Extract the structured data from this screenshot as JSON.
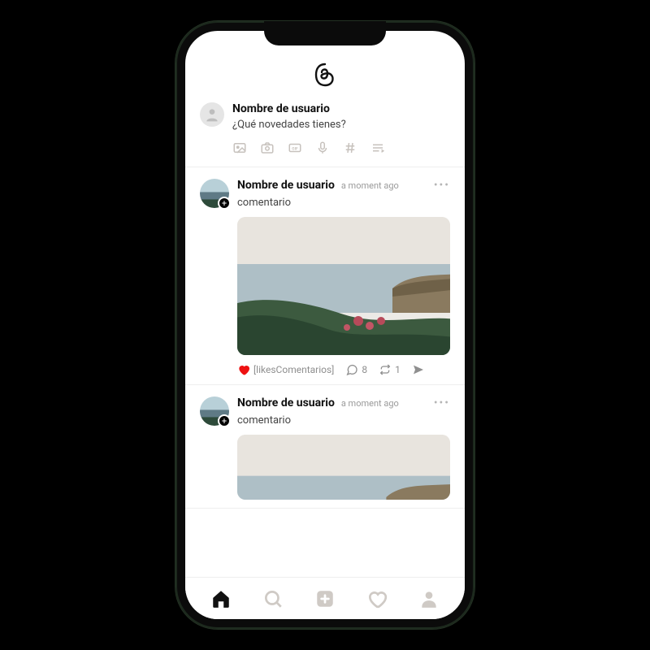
{
  "composer": {
    "username": "Nombre de usuario",
    "prompt": "¿Qué novedades tienes?"
  },
  "posts": [
    {
      "username": "Nombre de usuario",
      "time": "a moment ago",
      "text": "comentario",
      "likes_label": "[likesComentarios]",
      "comments": "8",
      "reposts": "1"
    },
    {
      "username": "Nombre de usuario",
      "time": "a moment ago",
      "text": "comentario"
    }
  ]
}
